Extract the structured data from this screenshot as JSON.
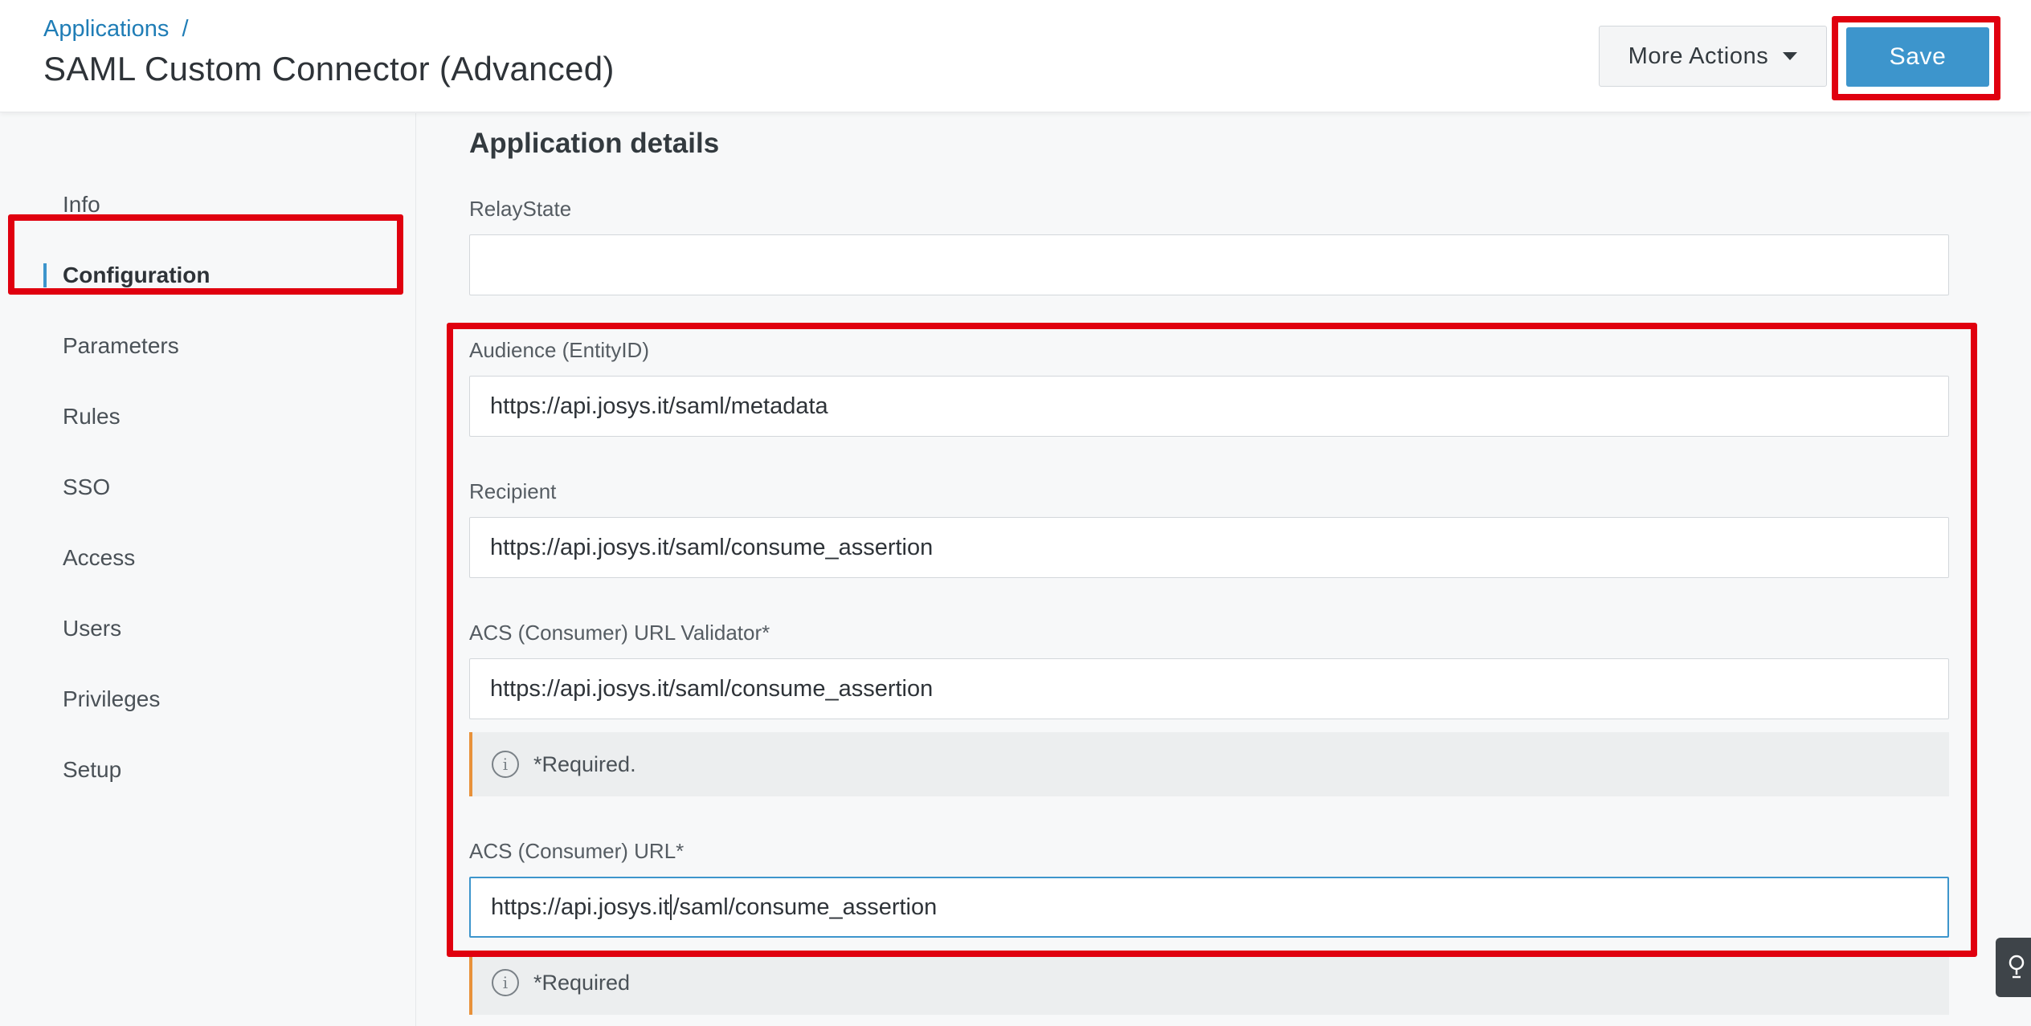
{
  "header": {
    "breadcrumb_link": "Applications",
    "breadcrumb_sep": "/",
    "title": "SAML Custom Connector (Advanced)",
    "more_actions_label": "More Actions",
    "save_label": "Save"
  },
  "sidebar": {
    "items": [
      {
        "label": "Info"
      },
      {
        "label": "Configuration",
        "active": true
      },
      {
        "label": "Parameters"
      },
      {
        "label": "Rules"
      },
      {
        "label": "SSO"
      },
      {
        "label": "Access"
      },
      {
        "label": "Users"
      },
      {
        "label": "Privileges"
      },
      {
        "label": "Setup"
      }
    ]
  },
  "main": {
    "section_title": "Application details",
    "fields": {
      "relay_state": {
        "label": "RelayState",
        "value": ""
      },
      "audience": {
        "label": "Audience (EntityID)",
        "value": "https://api.josys.it/saml/metadata"
      },
      "recipient": {
        "label": "Recipient",
        "value": "https://api.josys.it/saml/consume_assertion"
      },
      "acs_validator": {
        "label": "ACS (Consumer) URL Validator*",
        "value": "https://api.josys.it/saml/consume_assertion",
        "notice": "*Required."
      },
      "acs_url": {
        "label": "ACS (Consumer) URL*",
        "value_before_cursor": "https://api.josys.it",
        "value_after_cursor": "/saml/consume_assertion",
        "notice": "*Required"
      }
    }
  },
  "colors": {
    "accent": "#3d95cc",
    "link": "#1f7db6",
    "highlight": "#e0000f",
    "notice_border": "#e8913a"
  },
  "icons": {
    "more_actions": "caret-down-icon",
    "notice": "info-icon",
    "hint": "lightbulb-icon"
  }
}
